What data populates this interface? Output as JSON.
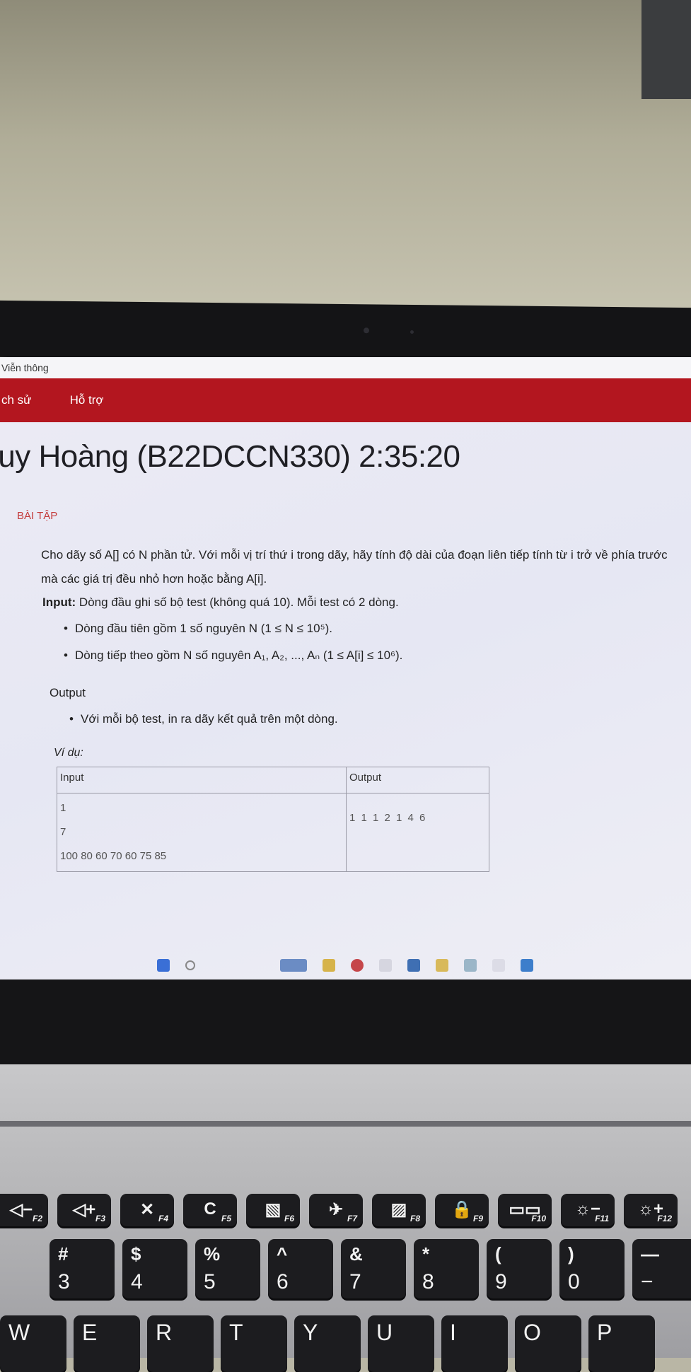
{
  "browser": {
    "tab_title": "Viễn thông"
  },
  "nav": {
    "items": [
      "ch sử",
      "Hỗ trợ"
    ]
  },
  "header": {
    "title": "luy Hoàng (B22DCCN330) 2:35:20"
  },
  "section": {
    "label": "BÀI TẬP"
  },
  "problem": {
    "statement": "Cho dãy số A[] có N phần tử. Với mỗi vị trí thứ i trong dãy, hãy tính độ dài của đoạn liên tiếp tính từ i trở về phía trước mà các giá trị đều nhỏ hơn hoặc bằng A[i].",
    "input_label": "Input:",
    "input_text": " Dòng đầu ghi số bộ test (không quá 10). Mỗi test có 2 dòng.",
    "input_bullets": [
      "Dòng đầu tiên gồm 1 số nguyên N (1 ≤ N ≤ 10⁵).",
      "Dòng tiếp theo gồm N số nguyên A₁, A₂, ..., Aₙ (1 ≤ A[i] ≤ 10⁶)."
    ],
    "output_label": "Output",
    "output_bullets": [
      "Với mỗi bộ test, in ra dãy kết quả trên một dòng."
    ],
    "example_label": "Ví dụ:",
    "example_table": {
      "headers": [
        "Input",
        "Output"
      ],
      "input_lines": [
        "1",
        "7",
        "100 80 60 70 60 75 85"
      ],
      "output": "1 1 1 2 1 4 6"
    }
  },
  "keyboard": {
    "fkeys": [
      {
        "icon": "◁−",
        "label": "F2"
      },
      {
        "icon": "◁+",
        "label": "F3"
      },
      {
        "icon": "✕",
        "label": "F4"
      },
      {
        "icon": "C",
        "label": "F5"
      },
      {
        "icon": "▧",
        "label": "F6"
      },
      {
        "icon": "✈",
        "label": "F7"
      },
      {
        "icon": "▨",
        "label": "F8"
      },
      {
        "icon": "🔒",
        "label": "F9"
      },
      {
        "icon": "▭▭",
        "label": "F10"
      },
      {
        "icon": "☼−",
        "label": "F11"
      },
      {
        "icon": "☼+",
        "label": "F12"
      }
    ],
    "number_keys": [
      {
        "sym": "#",
        "num": "3"
      },
      {
        "sym": "$",
        "num": "4"
      },
      {
        "sym": "%",
        "num": "5"
      },
      {
        "sym": "^",
        "num": "6"
      },
      {
        "sym": "&",
        "num": "7"
      },
      {
        "sym": "*",
        "num": "8"
      },
      {
        "sym": "(",
        "num": "9"
      },
      {
        "sym": ")",
        "num": "0"
      },
      {
        "sym": "—",
        "num": "−"
      }
    ],
    "letter_keys": [
      "W",
      "E",
      "R",
      "T",
      "Y",
      "U",
      "I",
      "O",
      "P"
    ]
  }
}
